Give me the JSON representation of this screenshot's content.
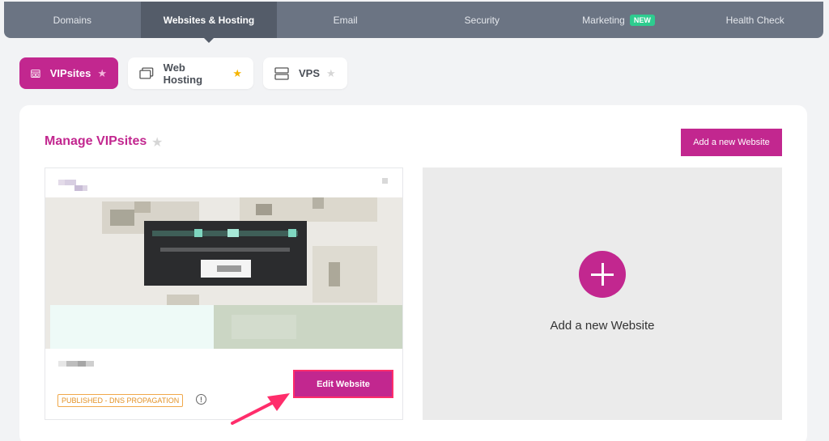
{
  "nav": {
    "tabs": [
      {
        "label": "Domains"
      },
      {
        "label": "Websites & Hosting"
      },
      {
        "label": "Email"
      },
      {
        "label": "Security"
      },
      {
        "label": "Marketing",
        "badge": "NEW"
      },
      {
        "label": "Health Check"
      }
    ]
  },
  "products": {
    "vipsites": "VIPsites",
    "web_hosting": "Web Hosting",
    "vps": "VPS"
  },
  "manage": {
    "title": "Manage VIPsites",
    "add_button": "Add a new Website"
  },
  "site": {
    "edit_button": "Edit Website",
    "status": "PUBLISHED - DNS PROPAGATION",
    "info_glyph": "!"
  },
  "add_panel": {
    "label": "Add a new Website"
  },
  "colors": {
    "accent": "#c2278f",
    "nav": "#6b7483",
    "status": "#e39227",
    "star_active": "#f5b400"
  }
}
